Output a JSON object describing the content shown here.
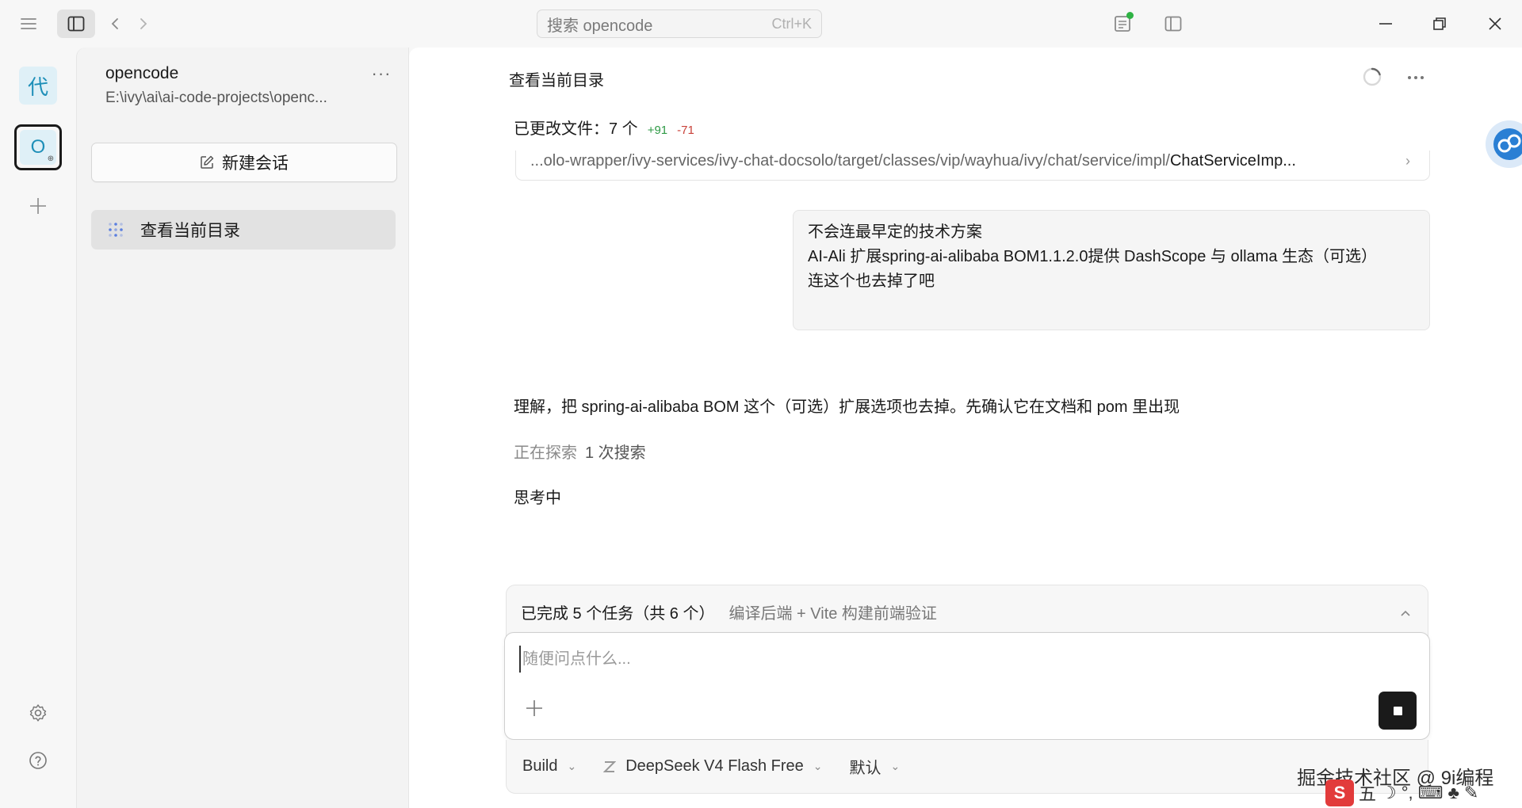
{
  "titlebar": {
    "search_placeholder": "搜索 opencode",
    "search_shortcut": "Ctrl+K"
  },
  "rail": {
    "projects": [
      {
        "initial": "代"
      },
      {
        "initial": "O"
      }
    ]
  },
  "sessions_panel": {
    "project_name": "opencode",
    "project_path": "E:\\ivy\\ai\\ai-code-projects\\openc...",
    "more_label": "···",
    "new_session_label": "新建会话",
    "items": [
      {
        "label": "查看当前目录"
      }
    ]
  },
  "main": {
    "title": "查看当前目录",
    "changed_files": {
      "label": "已更改文件：7 个",
      "additions": "+91",
      "deletions": "-71"
    },
    "file_row": {
      "path_prefix": "...olo-wrapper/ivy-services/ivy-chat-docsolo/target/classes/vip/wayhua/ivy/chat/service/impl/",
      "file_name": "ChatServiceImp..."
    },
    "user_message": [
      "不会连最早定的技术方案",
      "AI-Ali 扩展spring-ai-alibaba BOM1.1.2.0提供 DashScope 与 ollama 生态（可选）",
      "连这个也去掉了吧"
    ],
    "assistant_text": "理解，把 spring-ai-alibaba BOM 这个（可选）扩展选项也去掉。先确认它在文档和 pom 里出现",
    "exploring": {
      "label": "正在探索",
      "count": "1 次搜索"
    },
    "thinking": "思考中"
  },
  "composer": {
    "tasks_done": "已完成 5 个任务（共 6 个）",
    "tasks_current": "编译后端 + Vite 构建前端验证",
    "placeholder": "随便问点什么...",
    "options": {
      "agent": "Build",
      "model": "DeepSeek V4 Flash Free",
      "variant": "默认"
    }
  },
  "overlay": {
    "watermark": "掘金技术社区 @ 9i编程",
    "ime_label": "五"
  },
  "colors": {
    "accent_green": "#2fb344",
    "added": "#2f9a46",
    "deleted": "#c9423a",
    "project_tile": "#dff0f7"
  }
}
